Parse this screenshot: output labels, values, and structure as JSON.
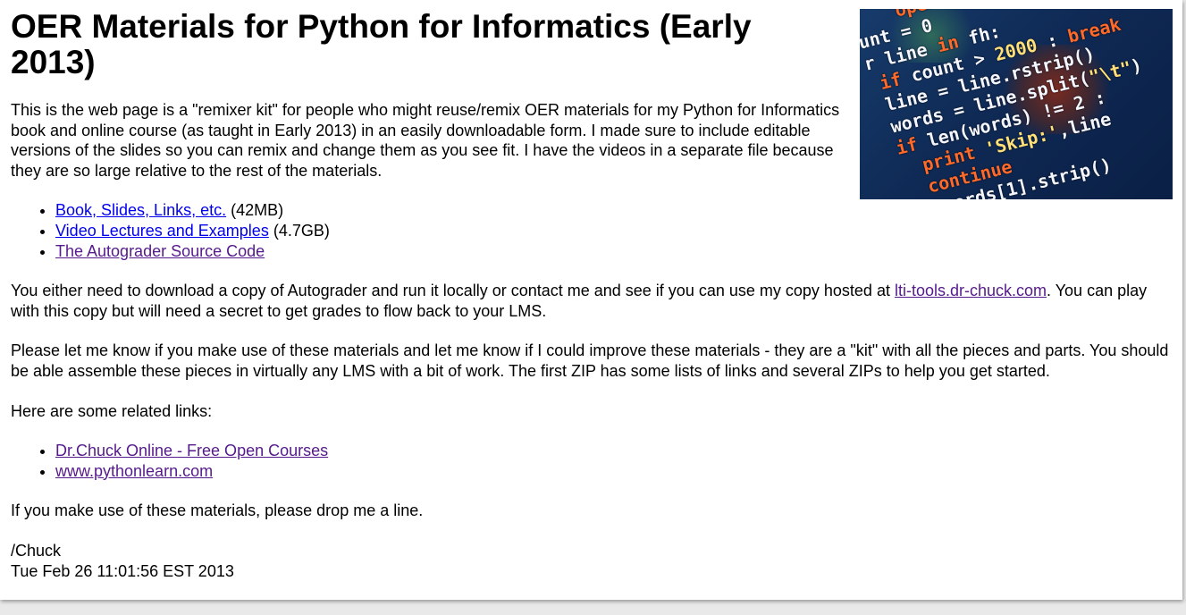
{
  "page": {
    "title": "OER Materials for Python for Informatics (Early 2013)",
    "intro": "This is the web page is a \"remixer kit\" for people who might reuse/remix OER materials for my Python for Informatics book and online course (as taught in Early 2013) in an easily downloadable form. I made sure to include editable versions of the slides so you can remix and change them as you see fit. I have the videos in a separate file because they are so large relative to the rest of the materials.",
    "downloads": [
      {
        "label": "Book, Slides, Links, etc.",
        "size": "(42MB)"
      },
      {
        "label": "Video Lectures and Examples",
        "size": "(4.7GB)"
      },
      {
        "label": "The Autograder Source Code",
        "size": ""
      }
    ],
    "autograder": {
      "before": "You either need to download a copy of Autograder and run it locally or contact me and see if you can use my copy hosted at ",
      "link": "lti-tools.dr-chuck.com",
      "after": ". You can play with this copy but will need a secret to get grades to flow back to your LMS."
    },
    "feedback": "Please let me know if you make use of these materials and let me know if I could improve these materials - they are a \"kit\" with all the pieces and parts. You should be able assemble these pieces in virtually any LMS with a bit of work. The first ZIP has some lists of links and several ZIPs to help you get started.",
    "related_heading": "Here are some related links:",
    "related": [
      {
        "label": "Dr.Chuck Online - Free Open Courses"
      },
      {
        "label": "www.pythonlearn.com"
      }
    ],
    "closing": "If you make use of these materials, please drop me a line.",
    "signature": "/Chuck",
    "timestamp": "Tue Feb 26 11:01:56 EST 2013"
  },
  "colors": {
    "link": "#0000ee",
    "visited_link": "#551a8b",
    "banner_bg": "#0f2a55"
  }
}
